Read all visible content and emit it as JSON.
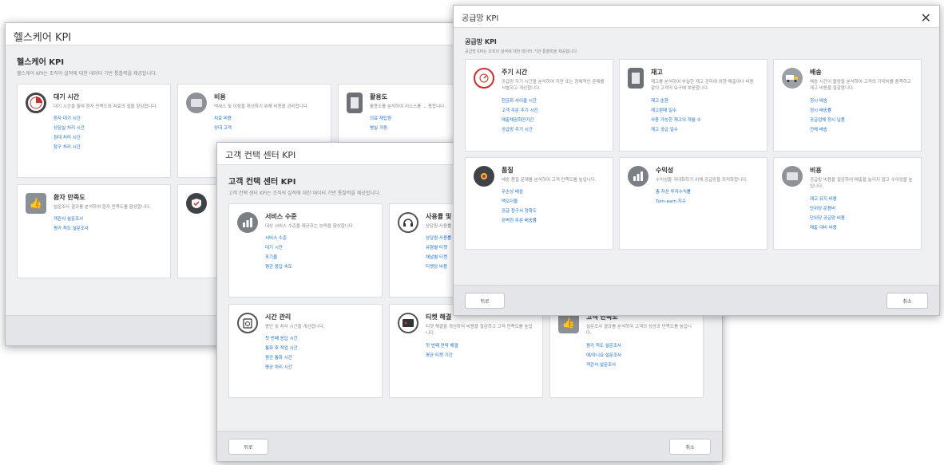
{
  "healthcare": {
    "title": "헬스케어 KPI",
    "heading": "헬스케어 KPI",
    "description": "헬스케어 KPI는 조직의 실적에 대한 데이터 기반 통찰력을 제공합니다.",
    "cards": [
      {
        "title": "대기 시간",
        "desc": "대기 시간을 줄여 환자 만족도와 치료의 질을 향상합니다.",
        "links": [
          "환자 대기 시간",
          "상담실 처리 시간",
          "침대 처리 시간",
          "청구 처리 시간"
        ]
      },
      {
        "title": "비용",
        "desc": "액세스 및 이점을 개선하기 위해 비용을 관리합니다.",
        "links": [
          "치료 비용",
          "상대 고객"
        ]
      },
      {
        "title": "활용도",
        "desc": "활용도를 분석하여 리소스를 ... 용합니다.",
        "links": [
          "의료 재입원",
          "병실 가동"
        ]
      },
      {
        "title": "환자 만족도",
        "desc": "설문조사 결과를 분석하여 환자 만족도를 향상합니다.",
        "links": [
          "객관식 설문조사",
          "평가 척도 설문조사"
        ]
      }
    ]
  },
  "contact_center": {
    "title": "고객 컨택 센터 KPI",
    "heading": "고객 컨택 센터 KPI",
    "description": "고객 컨택 센터 KPI는 조직의 실적에 대한 데이터 기반 통찰력을 제공합니다.",
    "cards": [
      {
        "title": "서비스 수준",
        "desc": "대상 서비스 수준을 제공하는 능력을 향상합니다.",
        "links": [
          "서비스 수준",
          "대기 시간",
          "포기율",
          "평균 응답 속도"
        ]
      },
      {
        "title": "사용률 및 ...",
        "desc": "상담원 사용률 ... 대한 활용 ...",
        "links": [
          "상담원 사용률",
          "유형별 티켓",
          "채널별 티켓",
          "티켓당 비용"
        ]
      },
      {
        "title": "시간 관리",
        "desc": "종단 및 처리 시간을 개선합니다.",
        "links": [
          "첫 번째 응답 시간",
          "통화 후 작업 시간",
          "평균 통화 시간",
          "평균 처리 시간"
        ]
      },
      {
        "title": "티켓 해결",
        "desc": "티켓 해결을 개선하여 비용을 절감하고 고객 만족도를 높입니다.",
        "links": [
          "첫 번째 연락 해결",
          "평균 티켓 기간"
        ]
      },
      {
        "title": "고객 만족도",
        "desc": "설문조사 결과를 분석하여 고객의 성공과 만족도를 높입니다.",
        "links": [
          "평가 척도 설문조사",
          "예/아니요 설문조사",
          "객관식 설문조사"
        ]
      }
    ],
    "back_label": "뒤로",
    "cancel_label": "취소"
  },
  "supply_chain": {
    "title": "공급망 KPI",
    "heading": "공급망 KPI",
    "description": "공급망 KPI는 조직의 실적에 대한 데이터 기반 통찰력을 제공합니다.",
    "cards": [
      {
        "title": "주기 시간",
        "desc": "공급망 주기 시간을 분석하여 지연 또는 장애적인 문제를 식별하고 개선합니다.",
        "links": [
          "현금화 사이클 시간",
          "고객 주문 주기 시간",
          "매출채권회전기간",
          "공급망 주기 시간"
        ]
      },
      {
        "title": "재고",
        "desc": "재고를 분석하여 부실한 재고 관리에 의한 매출이나 비용 같이 고객의 요구에 부응합니다.",
        "links": [
          "재고 순환",
          "재고판매 일수",
          "사용 가능한 재고의 개월 수",
          "재고 공급 일수"
        ]
      },
      {
        "title": "배송",
        "desc": "배송 시간이 물량을 분석하여 고객의 기대치를 충족하고 재고 비용을 절감합니다.",
        "links": [
          "정시 배송",
          "정시 배송률",
          "공급업체 정시 납품",
          "전체 배송"
        ]
      },
      {
        "title": "품질",
        "desc": "배송 품질 문제를 분석하여 고객 만족도를 높입니다.",
        "links": [
          "무손상 배송",
          "백오더율",
          "공급 청구서 정확도",
          "완벽한 주문 배송률"
        ]
      },
      {
        "title": "수익성",
        "desc": "수익성을 극대화하기 위해 공급망을 최적화합니다.",
        "links": [
          "총 자산 투자수익률",
          "Turn-earn 지수"
        ]
      },
      {
        "title": "비용",
        "desc": "공급망 비용을 절감하여 매출을 늘리지 않고 수익성을 높입니다.",
        "links": [
          "재고 유지 비용",
          "단위당 운용비",
          "단위당 공급망 비용",
          "매출 대비 비용"
        ]
      }
    ],
    "back_label": "뒤로",
    "cancel_label": "취소"
  },
  "colors": {
    "link": "#1a6fd0",
    "icon_red": "#c9302c",
    "window_bg": "#eff0f2"
  }
}
